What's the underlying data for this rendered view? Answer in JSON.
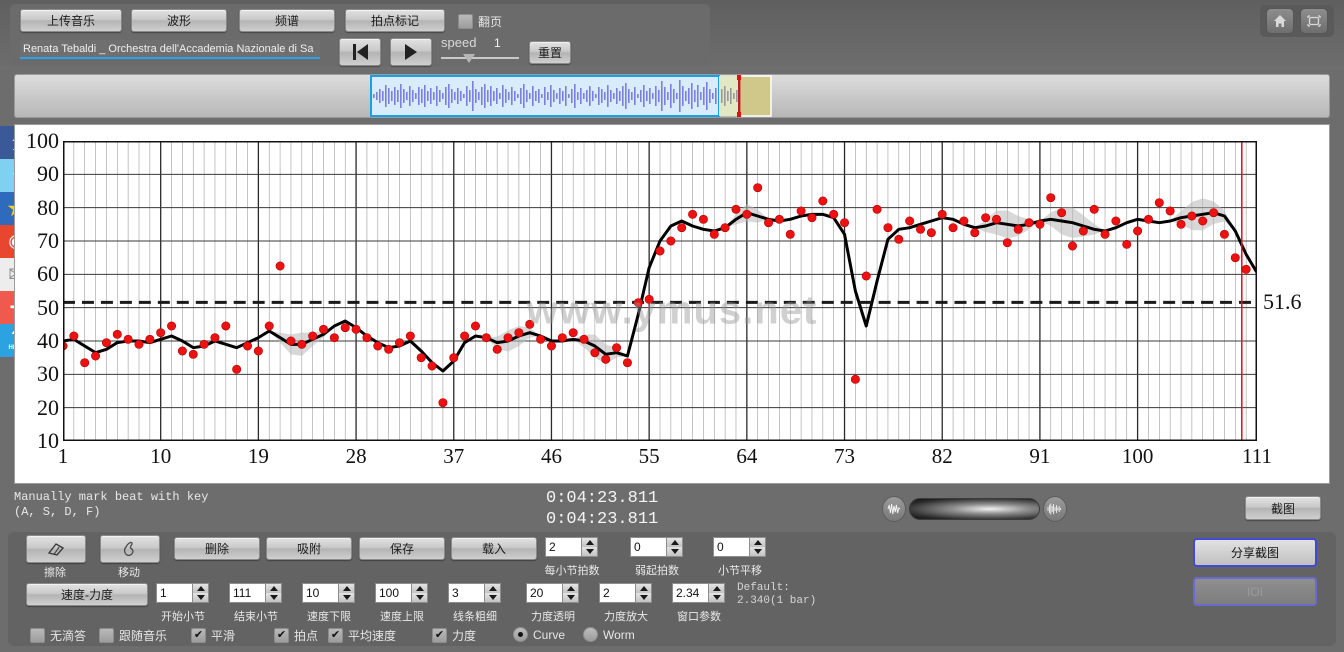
{
  "toolbar": {
    "buttons": [
      {
        "label": "上传音乐",
        "name": "upload-music-button"
      },
      {
        "label": "波形",
        "name": "waveform-button"
      },
      {
        "label": "频谱",
        "name": "spectrum-button"
      },
      {
        "label": "拍点标记",
        "name": "beat-marker-button"
      }
    ],
    "page_flip_label": "翻页",
    "page_flip_checked": false,
    "song_title": "Renata Tebaldi _ Orchestra dell'Accademia Nazionale di Sa",
    "speed_label": "speed",
    "speed_value": "1",
    "reset_label": "重置",
    "home_icon": "home-icon",
    "fullscreen_icon": "fullscreen-icon"
  },
  "social": [
    {
      "name": "facebook-icon",
      "glyph": "f",
      "bg": "#3b5998",
      "fg": "#ffffff"
    },
    {
      "name": "twitter-icon",
      "glyph": "t",
      "bg": "#7ed2f0",
      "fg": "#ffffff"
    },
    {
      "name": "qzone-icon",
      "glyph": "★",
      "bg": "#2f6bbd",
      "fg": "#ffd400"
    },
    {
      "name": "weibo-icon",
      "glyph": "◉",
      "bg": "#e8462f",
      "fg": "#ffffff"
    },
    {
      "name": "email-icon",
      "glyph": "✉",
      "bg": "#e9e9e9",
      "fg": "#8a8a8a"
    },
    {
      "name": "share-more-icon",
      "glyph": "+",
      "bg": "#f05a4e",
      "fg": "#ffffff"
    },
    {
      "name": "help-icon",
      "glyph": "?",
      "bg": "#2aa3e0",
      "fg": "#ffffff",
      "sub": "HELP"
    }
  ],
  "status": {
    "hint_line1": "Manually mark beat with key",
    "hint_line2": "(A, S, D, F)",
    "time_current": "0:04:23.811",
    "time_total": "0:04:23.811",
    "capture_label": "截图",
    "volume_left_icon": "waveform-small-icon",
    "volume_right_icon": "waveform-dense-icon"
  },
  "bottom": {
    "tools": [
      {
        "label": "擦除",
        "name": "erase-tool-button",
        "icon": "eraser-icon"
      },
      {
        "label": "移动",
        "name": "move-tool-button",
        "icon": "hand-icon"
      }
    ],
    "actions": [
      {
        "label": "删除",
        "name": "delete-button"
      },
      {
        "label": "吸附",
        "name": "snap-button"
      },
      {
        "label": "保存",
        "name": "save-button"
      },
      {
        "label": "载入",
        "name": "load-button"
      }
    ],
    "mode_button": "速度-力度",
    "spinners_row0": [
      {
        "label": "每小节拍数",
        "value": "2",
        "name": "beats-per-bar-spinner"
      },
      {
        "label": "弱起拍数",
        "value": "0",
        "name": "pickup-beats-spinner"
      },
      {
        "label": "小节平移",
        "value": "0",
        "name": "bar-offset-spinner"
      }
    ],
    "spinners_row1": [
      {
        "label": "开始小节",
        "value": "1",
        "name": "start-bar-spinner"
      },
      {
        "label": "结束小节",
        "value": "111",
        "name": "end-bar-spinner"
      },
      {
        "label": "速度下限",
        "value": "10",
        "name": "tempo-min-spinner"
      },
      {
        "label": "速度上限",
        "value": "100",
        "name": "tempo-max-spinner"
      },
      {
        "label": "线条粗细",
        "value": "3",
        "name": "line-width-spinner"
      },
      {
        "label": "力度透明",
        "value": "20",
        "name": "dynamics-opacity-spinner"
      },
      {
        "label": "力度放大",
        "value": "2",
        "name": "dynamics-scale-spinner"
      },
      {
        "label": "窗口参数",
        "value": "2.34",
        "name": "window-param-spinner"
      }
    ],
    "default_note_l1": "Default:",
    "default_note_l2": "2.340(1 bar)",
    "checkboxes": [
      {
        "label": "无滴答",
        "checked": false,
        "name": "no-tick-checkbox"
      },
      {
        "label": "跟随音乐",
        "checked": false,
        "name": "follow-music-checkbox"
      },
      {
        "label": "平滑",
        "checked": true,
        "name": "smooth-checkbox"
      },
      {
        "label": "拍点",
        "checked": true,
        "name": "beats-checkbox"
      },
      {
        "label": "平均速度",
        "checked": true,
        "name": "average-tempo-checkbox"
      },
      {
        "label": "力度",
        "checked": true,
        "name": "dynamics-checkbox"
      }
    ],
    "radios": [
      {
        "label": "Curve",
        "selected": true,
        "name": "curve-radio"
      },
      {
        "label": "Worm",
        "selected": false,
        "name": "worm-radio"
      }
    ],
    "share_label": "分享截图",
    "ioi_label": "IOI"
  },
  "chart_data": {
    "type": "line",
    "title": "",
    "xlabel": "",
    "ylabel": "",
    "watermark": "www.ymus.net",
    "xlim": [
      1,
      111
    ],
    "ylim": [
      10,
      100
    ],
    "xticks": [
      1,
      10,
      19,
      28,
      37,
      46,
      55,
      64,
      73,
      82,
      91,
      100,
      111
    ],
    "yticks": [
      10,
      20,
      30,
      40,
      50,
      60,
      70,
      80,
      90,
      100
    ],
    "grid": true,
    "threshold_line": {
      "value": 51.6,
      "label": "51.6",
      "style": "dashed"
    },
    "cursor_line": {
      "x": 109.6,
      "color": "#e01010"
    },
    "series": [
      {
        "name": "smoothed tempo curve",
        "type": "line",
        "color": "#000000",
        "width": 3,
        "x": [
          1,
          2,
          3,
          4,
          5,
          6,
          7,
          8,
          9,
          10,
          11,
          12,
          13,
          14,
          15,
          16,
          17,
          18,
          19,
          20,
          21,
          22,
          23,
          24,
          25,
          26,
          27,
          28,
          29,
          30,
          31,
          32,
          33,
          34,
          35,
          36,
          37,
          38,
          39,
          40,
          41,
          42,
          43,
          44,
          45,
          46,
          47,
          48,
          49,
          50,
          51,
          52,
          53,
          54,
          55,
          56,
          57,
          58,
          59,
          60,
          61,
          62,
          63,
          64,
          65,
          66,
          67,
          68,
          69,
          70,
          71,
          72,
          73,
          74,
          75,
          76,
          77,
          78,
          79,
          80,
          81,
          82,
          83,
          84,
          85,
          86,
          87,
          88,
          89,
          90,
          91,
          92,
          93,
          94,
          95,
          96,
          97,
          98,
          99,
          100,
          101,
          102,
          103,
          104,
          105,
          106,
          107,
          108,
          109,
          110,
          111
        ],
        "y": [
          40.0,
          40.5,
          38.5,
          36.5,
          37.5,
          39.5,
          40.0,
          40.0,
          39.5,
          40.5,
          41.5,
          40.0,
          38.0,
          38.5,
          40.0,
          39.0,
          38.0,
          39.5,
          41.0,
          43.0,
          41.0,
          39.0,
          39.0,
          40.5,
          42.0,
          44.5,
          46.0,
          44.0,
          41.5,
          39.5,
          38.0,
          38.5,
          40.0,
          37.0,
          33.5,
          31.0,
          34.0,
          39.5,
          41.5,
          41.0,
          39.5,
          40.0,
          41.5,
          42.5,
          41.5,
          40.0,
          40.0,
          40.5,
          40.0,
          38.5,
          36.0,
          36.5,
          35.5,
          48.0,
          62.0,
          70.0,
          74.5,
          76.0,
          74.5,
          73.5,
          73.0,
          74.0,
          76.5,
          78.5,
          77.5,
          76.5,
          76.0,
          76.5,
          77.5,
          78.0,
          78.0,
          77.0,
          72.0,
          55.0,
          44.5,
          58.0,
          70.5,
          73.5,
          74.0,
          75.0,
          76.0,
          77.0,
          76.5,
          75.0,
          74.0,
          74.5,
          75.5,
          75.0,
          74.5,
          75.0,
          76.0,
          76.5,
          76.0,
          75.5,
          74.5,
          73.5,
          73.0,
          74.0,
          75.5,
          76.5,
          76.0,
          75.5,
          76.0,
          77.0,
          77.5,
          78.0,
          78.5,
          77.5,
          73.0,
          66.0,
          60.5
        ]
      },
      {
        "name": "beat tempo scatter",
        "type": "scatter",
        "color": "#ee1111",
        "x": [
          1,
          2,
          3,
          4,
          5,
          6,
          7,
          8,
          9,
          10,
          11,
          12,
          13,
          14,
          15,
          16,
          17,
          18,
          19,
          20,
          21,
          22,
          23,
          24,
          25,
          26,
          27,
          28,
          29,
          30,
          31,
          32,
          33,
          34,
          35,
          36,
          37,
          38,
          39,
          40,
          41,
          42,
          43,
          44,
          45,
          46,
          47,
          48,
          49,
          50,
          51,
          52,
          53,
          54,
          55,
          56,
          57,
          58,
          59,
          60,
          61,
          62,
          63,
          64,
          65,
          66,
          67,
          68,
          69,
          70,
          71,
          72,
          73,
          74,
          75,
          76,
          77,
          78,
          79,
          80,
          81,
          82,
          83,
          84,
          85,
          86,
          87,
          88,
          89,
          90,
          91,
          92,
          93,
          94,
          95,
          96,
          97,
          98,
          99,
          100,
          101,
          102,
          103,
          104,
          105,
          106,
          107,
          108,
          109,
          110
        ],
        "y": [
          38.5,
          41.5,
          33.5,
          35.5,
          39.5,
          42.0,
          40.5,
          39.0,
          40.5,
          42.5,
          44.5,
          37.0,
          36.0,
          39.0,
          41.0,
          44.5,
          31.5,
          38.5,
          37.0,
          44.5,
          62.5,
          40.0,
          39.0,
          41.5,
          43.5,
          41.0,
          44.0,
          43.5,
          41.0,
          38.5,
          37.5,
          39.5,
          41.5,
          35.0,
          32.5,
          21.5,
          35.0,
          41.5,
          44.5,
          41.0,
          37.5,
          41.0,
          42.5,
          45.0,
          40.5,
          38.5,
          41.0,
          42.5,
          40.5,
          36.5,
          34.5,
          38.0,
          33.5,
          51.5,
          52.5,
          67.0,
          70.0,
          74.0,
          78.0,
          76.5,
          72.0,
          74.0,
          79.5,
          78.0,
          86.0,
          75.5,
          76.5,
          72.0,
          79.0,
          77.0,
          82.0,
          78.0,
          75.5,
          28.5,
          59.5,
          79.5,
          74.0,
          70.5,
          76.0,
          73.5,
          72.5,
          78.0,
          74.0,
          76.0,
          72.5,
          77.0,
          76.5,
          69.5,
          73.5,
          75.5,
          75.0,
          83.0,
          78.5,
          68.5,
          73.0,
          79.5,
          72.0,
          76.0,
          69.0,
          73.0,
          76.5,
          81.5,
          79.0,
          75.0,
          77.5,
          76.0,
          78.5,
          72.0,
          65.0,
          61.5
        ]
      }
    ],
    "confidence_band": {
      "name": "dynamics band",
      "color": "#b8b8b8",
      "opacity": 0.55
    }
  }
}
